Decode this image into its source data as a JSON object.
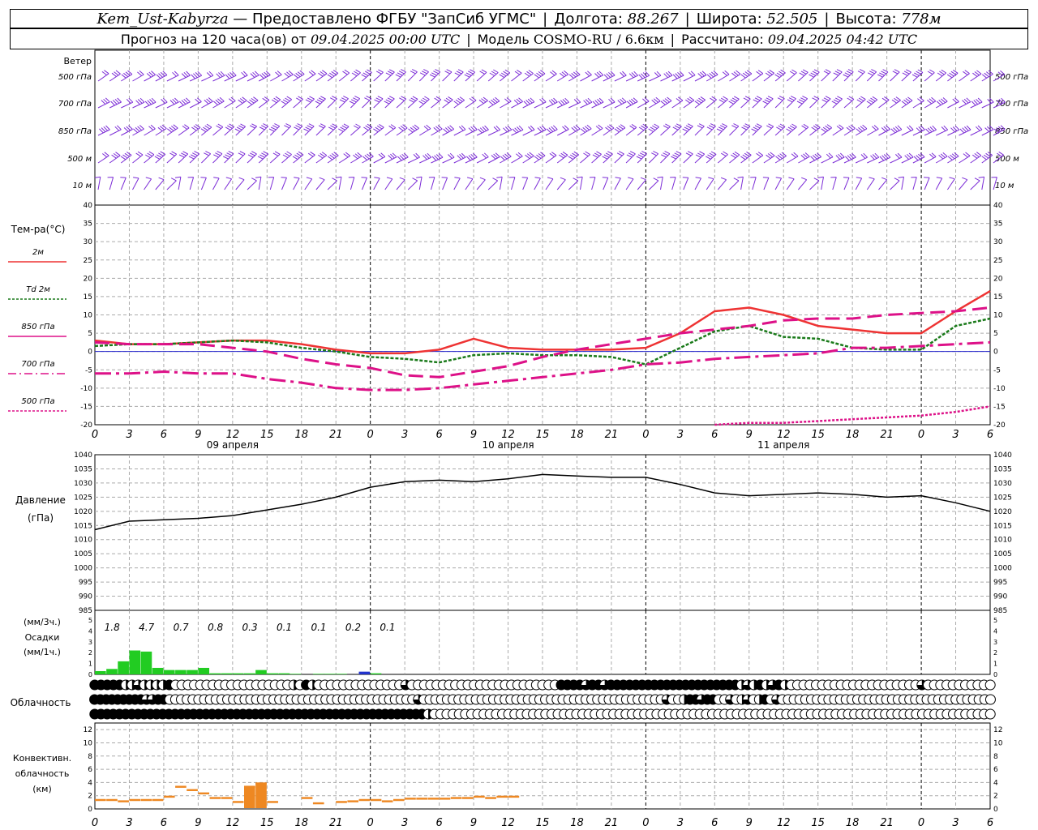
{
  "header": {
    "station": "Kem_Ust-Kabyrza",
    "provider": "— Предоставлено ФГБУ \"ЗапСиб УГМС\"",
    "lon_label": "Долгота:",
    "lon_value": "88.267",
    "lat_label": "Широта:",
    "lat_value": "52.505",
    "alt_label": "Высота:",
    "alt_value": "778м",
    "forecast_label": "Прогноз на 120 часа(ов) от",
    "forecast_from": "09.04.2025 00:00 UTC",
    "model_label": "Модель",
    "model_name": "COSMO-RU / 6.6км",
    "calc_label": "Рассчитано:",
    "calc_value": "09.04.2025 04:42 UTC"
  },
  "wind_panel": {
    "title": "Ветер",
    "levels": [
      "500 гПа",
      "700 гПа",
      "850 гПа",
      "500 м",
      "10  м"
    ],
    "right_levels": [
      "500 гПа",
      "700 гПа",
      "850 гПа",
      "500 м",
      "10  м"
    ]
  },
  "temp_panel": {
    "title": "Тем-ра(°C)",
    "legend": [
      {
        "label": "2м",
        "color": "#ee3333"
      },
      {
        "label": "Td  2м",
        "color": "#1a7a1a"
      },
      {
        "label": "850 гПа",
        "color": "#dd1188"
      },
      {
        "label": "700 гПа",
        "color": "#dd1188"
      },
      {
        "label": "500 гПа",
        "color": "#dd1188"
      }
    ],
    "yticks": [
      "40",
      "35",
      "30",
      "25",
      "20",
      "15",
      "10",
      "5",
      "0",
      "-5",
      "-10",
      "-15",
      "-20"
    ]
  },
  "xaxis": {
    "ticks": [
      "0",
      "3",
      "6",
      "9",
      "12",
      "15",
      "18",
      "21",
      "0",
      "3",
      "6",
      "9",
      "12",
      "15",
      "18",
      "21",
      "0",
      "3",
      "6",
      "9",
      "12",
      "15",
      "18",
      "21",
      "0",
      "3",
      "6"
    ],
    "days": [
      "09 апреля",
      "10 апреля",
      "11 апреля"
    ]
  },
  "pressure_panel": {
    "title": "Давление",
    "unit": "(гПа)",
    "yticks": [
      "1040",
      "1035",
      "1030",
      "1025",
      "1020",
      "1015",
      "1010",
      "1005",
      "1000",
      "995",
      "990",
      "985"
    ]
  },
  "precip_panel": {
    "unit3": "(мм/3ч.)",
    "title": "Осадки",
    "unit1": "(мм/1ч.)",
    "yticks": [
      "5",
      "4",
      "3",
      "2",
      "1",
      "0"
    ],
    "totals3h": [
      "1.8",
      "4.7",
      "0.7",
      "0.8",
      "0.3",
      "0.1",
      "0.1",
      "0.2",
      "0.1"
    ]
  },
  "cloud_panel": {
    "title": "Облачность"
  },
  "conv_panel": {
    "title1": "Конвективн.",
    "title2": "облачность",
    "unit": "(км)",
    "yticks": [
      "12",
      "10",
      "8",
      "6",
      "4",
      "2",
      "0"
    ]
  },
  "chart_data": [
    {
      "type": "line",
      "title": "Тем-ра(°C)",
      "x_hours": [
        0,
        3,
        6,
        9,
        12,
        15,
        18,
        21,
        24,
        27,
        30,
        33,
        36,
        39,
        42,
        45,
        48,
        51,
        54,
        57,
        60,
        63,
        66,
        69,
        72,
        75,
        78
      ],
      "series": [
        {
          "name": "2м",
          "color": "#ee3333",
          "values": [
            3,
            2,
            2,
            2.5,
            3,
            3,
            2,
            0.5,
            -0.5,
            -0.5,
            0.5,
            3.5,
            1,
            0.5,
            0.5,
            0.5,
            1,
            5,
            11,
            12,
            10,
            7,
            6,
            5,
            5,
            11,
            16.5
          ]
        },
        {
          "name": "Td  2м",
          "color": "#1a7a1a",
          "values": [
            1.5,
            2,
            2,
            2.5,
            3,
            2.5,
            1,
            0,
            -1.5,
            -2,
            -3,
            -1,
            -0.5,
            -1,
            -1,
            -1.5,
            -3.5,
            1,
            5.5,
            7,
            4,
            3.5,
            1,
            0.5,
            0.5,
            7,
            9
          ]
        },
        {
          "name": "850 гПа",
          "color": "#dd1188",
          "values": [
            2.5,
            2,
            2,
            2,
            1,
            0,
            -2,
            -3.5,
            -4.5,
            -6.5,
            -7,
            -5.5,
            -4,
            -1.5,
            0.5,
            2,
            3.5,
            5,
            6,
            7,
            8.5,
            9,
            9,
            10,
            10.5,
            11,
            12
          ]
        },
        {
          "name": "700 гПа",
          "color": "#dd1188",
          "values": [
            -6,
            -6,
            -5.5,
            -6,
            -6,
            -7.5,
            -8.5,
            -10,
            -10.5,
            -10.5,
            -10,
            -9,
            -8,
            -7,
            -6,
            -5,
            -3.5,
            -3,
            -2,
            -1.5,
            -1,
            -0.5,
            1,
            1,
            1.5,
            2,
            2.5
          ]
        },
        {
          "name": "500 гПа",
          "color": "#dd1188",
          "values": [
            null,
            null,
            null,
            null,
            null,
            null,
            null,
            null,
            null,
            null,
            null,
            null,
            null,
            null,
            null,
            null,
            null,
            null,
            -20,
            -19.5,
            -19.5,
            -19,
            -18.5,
            -18,
            -17.5,
            -16.5,
            -15
          ]
        }
      ],
      "ylim": [
        -20,
        40
      ]
    },
    {
      "type": "line",
      "title": "Давление",
      "ylabel": "(гПа)",
      "x_hours": [
        0,
        3,
        6,
        9,
        12,
        15,
        18,
        21,
        24,
        27,
        30,
        33,
        36,
        39,
        42,
        45,
        48,
        51,
        54,
        57,
        60,
        63,
        66,
        69,
        72,
        75,
        78
      ],
      "series": [
        {
          "values": [
            1013.5,
            1016.5,
            1017,
            1017.5,
            1018.5,
            1020.5,
            1022.5,
            1025,
            1028.5,
            1030.5,
            1031,
            1030.5,
            1031.5,
            1033,
            1032.5,
            1032,
            1032,
            1029.5,
            1026.5,
            1025.5,
            1026,
            1026.5,
            1026,
            1025,
            1025.5,
            1023,
            1020
          ]
        }
      ],
      "ylim": [
        985,
        1040
      ]
    },
    {
      "type": "bar",
      "title": "Осадки",
      "ylabel": "(мм/1ч.)",
      "x_hours": [
        0,
        1,
        2,
        3,
        4,
        5,
        6,
        7,
        8,
        9,
        10,
        11,
        12,
        13,
        14,
        15,
        16,
        17,
        18,
        19,
        20,
        21,
        22,
        23,
        24,
        25
      ],
      "values": [
        0.3,
        0.5,
        1.2,
        2.2,
        2.1,
        0.6,
        0.4,
        0.4,
        0.4,
        0.6,
        0.1,
        0.1,
        0.1,
        0.1,
        0.4,
        0.1,
        0.1,
        0.05,
        0,
        0.05,
        0.05,
        0.05,
        0,
        0.25,
        0.1,
        0
      ],
      "ylim": [
        0,
        5
      ]
    },
    {
      "type": "bar",
      "title": "Конвективн. облачность",
      "ylabel": "(км)",
      "x_hours": [
        0,
        1,
        2,
        3,
        4,
        5,
        6,
        7,
        8,
        9,
        10,
        11,
        12,
        13,
        14,
        15,
        16,
        17,
        18,
        19,
        20,
        21,
        22,
        23,
        24,
        25,
        26,
        27,
        28,
        29,
        30,
        31,
        32,
        33,
        34,
        35,
        36
      ],
      "values": [
        1.5,
        1.5,
        1.3,
        1.5,
        1.5,
        1.5,
        2,
        3.5,
        3,
        2.5,
        1.8,
        1.8,
        1.2,
        3.5,
        4,
        1.2,
        0,
        0,
        1.8,
        1,
        0,
        1.2,
        1.3,
        1.5,
        1.5,
        1.3,
        1.5,
        1.7,
        1.7,
        1.7,
        1.7,
        1.8,
        1.8,
        2,
        1.8,
        2,
        2
      ],
      "ylim": [
        0,
        12
      ]
    }
  ],
  "cloud_rows": {
    "upper": "FFFFFHHQHHHHFOOOOOOOOOOOOOOOOOOOHOFHOOOOOOOOOOOOOOQOOOOOOOOOOOOOOOOOOOOOOOOFFFFQFFQFFFFFFFFFFFFFFFFFFFFFHQHFHQFHOOOOOOOOOOOOOOOOOOOOOQOOOOOOOOOOO",
    "middle": "FFFFFFFFFQQFFOOOOOOOOOOOOOOOOOOOOOOOOOOOOOOOOOOOOOOOOOOOQOOOOOOOOOOOOOOOOOOOOOOOOOOOOOOOOOOOOOOOOOOQOOHFFQFFOOQOHQOHFOQOOOOOOOOOOOOOOOOOOOOOOOOOOOOOOOOOOOOO",
    "lower": "FFFFFFFFFFFFFFFFFFFFFFFFFFFFFFFFFFFFFFFFFFFFFFFFFFFFFFHOOOOOOOOOOOOOOOOOOOOOOOOOOOOOOOOOOOOOOOOOOOOOOOOOOOOOOOOOOOOOOOOOOOOOOOOOOOOOOOOOOOOOOOOOOO"
  }
}
